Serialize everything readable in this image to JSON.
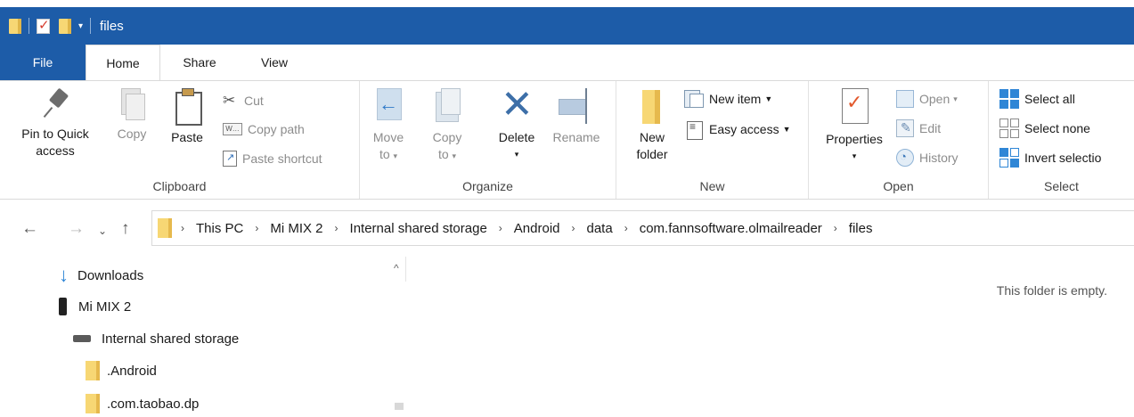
{
  "window": {
    "title": "files"
  },
  "tabs": {
    "file": "File",
    "home": "Home",
    "share": "Share",
    "view": "View"
  },
  "ribbon": {
    "clipboard": {
      "label": "Clipboard",
      "pin_line1": "Pin to Quick",
      "pin_line2": "access",
      "copy": "Copy",
      "paste": "Paste",
      "cut": "Cut",
      "copy_path": "Copy path",
      "paste_shortcut": "Paste shortcut"
    },
    "organize": {
      "label": "Organize",
      "move_to_line1": "Move",
      "move_to_line2": "to",
      "copy_to_line1": "Copy",
      "copy_to_line2": "to",
      "delete": "Delete",
      "rename": "Rename"
    },
    "new": {
      "label": "New",
      "new_folder_line1": "New",
      "new_folder_line2": "folder",
      "new_item": "New item",
      "easy_access": "Easy access"
    },
    "open": {
      "label": "Open",
      "properties": "Properties",
      "open": "Open",
      "edit": "Edit",
      "history": "History"
    },
    "select": {
      "label": "Select",
      "select_all": "Select all",
      "select_none": "Select none",
      "invert_selection": "Invert selectio"
    }
  },
  "address": {
    "crumbs": [
      "This PC",
      "Mi MIX 2",
      "Internal shared storage",
      "Android",
      "data",
      "com.fannsoftware.olmailreader",
      "files"
    ]
  },
  "nav": {
    "items": [
      "Downloads",
      "Mi MIX 2",
      "Internal shared storage",
      ".Android",
      ".com.taobao.dp"
    ]
  },
  "content": {
    "empty_message": "This folder is empty."
  },
  "colors": {
    "titlebar": "#1d5ca8",
    "folder": "#f7d774",
    "accent": "#2f86d6"
  }
}
